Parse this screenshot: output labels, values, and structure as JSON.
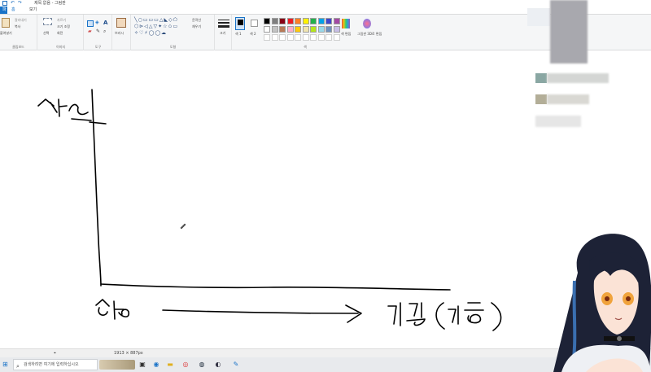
{
  "titlebar": {
    "title": "제목 없음 - 그림판"
  },
  "tabs": {
    "file": "파일",
    "home": "홈",
    "view": "보기"
  },
  "ribbon": {
    "clipboard": {
      "paste": "붙여넣기",
      "cut": "잘라내기",
      "copy": "복사",
      "label": "클립보드"
    },
    "image": {
      "select": "선택",
      "crop": "자르기",
      "resize": "크기 조정",
      "rotate": "회전",
      "label": "이미지"
    },
    "tools": {
      "label": "도구"
    },
    "brushes": {
      "label": "브러시"
    },
    "shapes": {
      "outline": "윤곽선",
      "fill": "채우기",
      "label": "도형"
    },
    "size": {
      "label": "크기"
    },
    "colors": {
      "color1": "색 1",
      "color2": "색 2",
      "edit": "색 편집",
      "label": "색",
      "paint3d": "그림판 3D로 편집",
      "palette": [
        "#000000",
        "#7f7f7f",
        "#880015",
        "#ed1c24",
        "#ff7f27",
        "#fff200",
        "#22b14c",
        "#00a2e8",
        "#3f48cc",
        "#a349a4",
        "#ffffff",
        "#c3c3c3",
        "#b97a57",
        "#ffaec9",
        "#ffc90e",
        "#efe4b0",
        "#b5e61d",
        "#99d9ea",
        "#7092be",
        "#c8bfe7"
      ],
      "accent": "#1a73c8"
    }
  },
  "statusbar": {
    "dimensions": "1913 × 887px"
  },
  "taskbar": {
    "search_placeholder": "검색하려면 여기에 입력하십시오"
  }
}
